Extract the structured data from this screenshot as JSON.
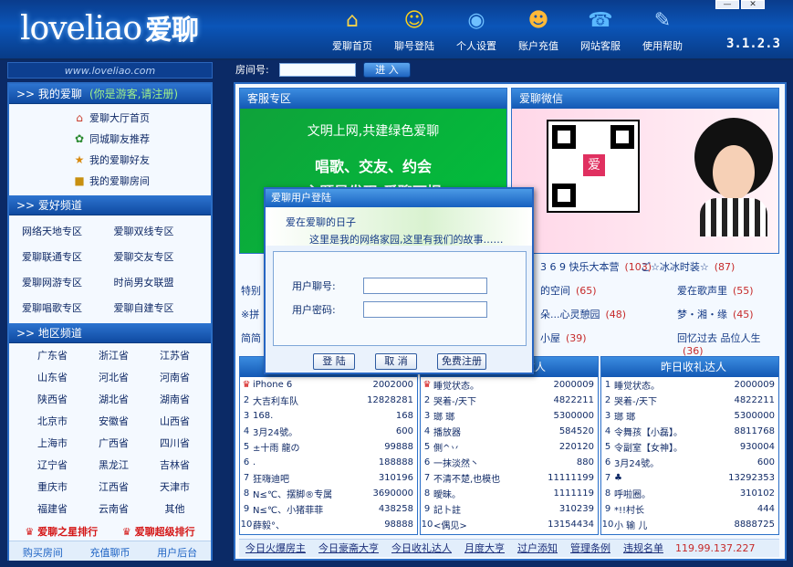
{
  "header": {
    "logo_en": "loveliao",
    "logo_cn": "爱聊",
    "version": "3.1.2.3",
    "minimize_label": "—",
    "close_label": "✕",
    "nav": [
      {
        "label": "爱聊首页",
        "icon": "home-icon",
        "glyph": "⌂"
      },
      {
        "label": "聊号登陆",
        "icon": "user-login-icon",
        "glyph": "☺"
      },
      {
        "label": "个人设置",
        "icon": "settings-icon",
        "glyph": "◉"
      },
      {
        "label": "账户充值",
        "icon": "recharge-icon",
        "glyph": "☻"
      },
      {
        "label": "网站客服",
        "icon": "support-icon",
        "glyph": "☎"
      },
      {
        "label": "使用帮助",
        "icon": "help-icon",
        "glyph": "✎"
      }
    ]
  },
  "urlbar": {
    "text": "www.loveliao.com"
  },
  "roombar": {
    "label": "房间号:",
    "input_value": "",
    "enter_label": "进 入"
  },
  "sidebar": {
    "my_head": ">> 我的爱聊",
    "my_note": "(你是游客,请注册)",
    "home_links": [
      {
        "label": "爱聊大厅首页",
        "glyph": "⌂"
      },
      {
        "label": "同城聊友推荐",
        "glyph": "✿"
      },
      {
        "label": "我的爱聊好友",
        "glyph": "★"
      },
      {
        "label": "我的爱聊房间",
        "glyph": "■"
      }
    ],
    "hobby_head": ">> 爱好频道",
    "hobby_items": [
      "网络天地专区",
      "爱聊双线专区",
      "爱聊联通专区",
      "爱聊交友专区",
      "爱聊网游专区",
      "时尚男女联盟",
      "爱聊唱歌专区",
      "爱聊自建专区"
    ],
    "region_head": ">> 地区频道",
    "region_items": [
      "广东省",
      "浙江省",
      "江苏省",
      "山东省",
      "河北省",
      "河南省",
      "陕西省",
      "湖北省",
      "湖南省",
      "北京市",
      "安徽省",
      "山西省",
      "上海市",
      "广西省",
      "四川省",
      "辽宁省",
      "黑龙江",
      "吉林省",
      "重庆市",
      "江西省",
      "天津市",
      "福建省",
      "云南省",
      "其他"
    ],
    "rank_star": "爱聊之星排行",
    "rank_super": "爱聊超级排行",
    "bottom_links": [
      "购买房间",
      "充值聊币",
      "用户后台"
    ]
  },
  "main": {
    "service_head": "客服专区",
    "service_l1": "文明上网,共建绿色爱聊",
    "service_l2": "唱歌、交友、约会",
    "service_l3": "主题是发现,爱聊可提",
    "wechat_head": "爱聊微信",
    "qr_mark": "爱",
    "mid_rows": [
      {
        "text": "3 6 9 快乐大本营",
        "num": "(103)"
      },
      {
        "text": "ご☆冰冰时装☆",
        "num": "(87)"
      },
      {
        "text": "的空间",
        "num": "(65)"
      },
      {
        "text": "爱在歌声里",
        "num": "(55)"
      },
      {
        "text": "朵...心灵憩园",
        "num": "(48)"
      },
      {
        "text": "梦・湘・缘",
        "num": "(45)"
      },
      {
        "text": "小屋",
        "num": "(39)"
      },
      {
        "text": "回忆过去 品位人生",
        "num": "(36)"
      }
    ],
    "mid_left": [
      "特别",
      "※拼",
      "简简"
    ],
    "panels": [
      {
        "head": "",
        "rows": [
          {
            "i": "♛",
            "name": "iPhone 6",
            "value": "2002000"
          },
          {
            "i": "2",
            "name": "大吉利车队",
            "value": "12828281"
          },
          {
            "i": "3",
            "name": "168.",
            "value": "168"
          },
          {
            "i": "4",
            "name": "3月24號。",
            "value": "600"
          },
          {
            "i": "5",
            "name": "±十雨 龍の",
            "value": "99888"
          },
          {
            "i": "6",
            "name": ".",
            "value": "188888"
          },
          {
            "i": "7",
            "name": "狂嗨迪吧",
            "value": "310196"
          },
          {
            "i": "8",
            "name": "N≤℃、摆脚®专属",
            "value": "3690000"
          },
          {
            "i": "9",
            "name": "N≤℃、小猪菲菲",
            "value": "438258"
          },
          {
            "i": "10",
            "name": "薛毅°、",
            "value": "98888"
          }
        ]
      },
      {
        "head": "今日收礼达人",
        "rows": [
          {
            "i": "♛",
            "name": "睡觉状态。",
            "value": "2000009"
          },
          {
            "i": "2",
            "name": "哭着-/天下",
            "value": "4822211"
          },
          {
            "i": "3",
            "name": "瑯 瑯",
            "value": "5300000"
          },
          {
            "i": "4",
            "name": "播放器",
            "value": "584520"
          },
          {
            "i": "5",
            "name": "側^丷",
            "value": "220120"
          },
          {
            "i": "6",
            "name": "一抹淡然丶",
            "value": "880"
          },
          {
            "i": "7",
            "name": "不清不楚,也模也",
            "value": "11111199"
          },
          {
            "i": "8",
            "name": "曖昧。",
            "value": "1111119"
          },
          {
            "i": "9",
            "name": "記卜註",
            "value": "310239"
          },
          {
            "i": "10",
            "name": "<偶见>",
            "value": "13154434"
          }
        ]
      },
      {
        "head": "昨日收礼达人",
        "rows": [
          {
            "i": "1",
            "name": "睡觉状态。",
            "value": "2000009"
          },
          {
            "i": "2",
            "name": "哭着-/天下",
            "value": "4822211"
          },
          {
            "i": "3",
            "name": "瑯 瑯",
            "value": "5300000"
          },
          {
            "i": "4",
            "name": "令舞孩【小磊】。",
            "value": "8811768"
          },
          {
            "i": "5",
            "name": "令副室【女神】。",
            "value": "930004"
          },
          {
            "i": "6",
            "name": "3月24號。",
            "value": "600"
          },
          {
            "i": "7",
            "name": "♣",
            "value": "13292353"
          },
          {
            "i": "8",
            "name": "呼啦圈。",
            "value": "310102"
          },
          {
            "i": "9",
            "name": "*!!村长",
            "value": "444"
          },
          {
            "i": "10",
            "name": "小 输 儿",
            "value": "8888725"
          }
        ]
      }
    ],
    "footer": [
      "今日火爆房主",
      "今日豪斋大亨",
      "今日收礼达人",
      "月度大亨",
      "过户添知",
      "管理条例",
      "违规名单"
    ],
    "footer_ip": "119.99.137.227"
  },
  "dialog": {
    "title": "爱聊用户登陆",
    "banner1": "爱在爱聊的日子",
    "banner2": "这里是我的网络家园,这里有我们的故事……",
    "user_label": "用户聊号:",
    "pass_label": "用户密码:",
    "user_value": "",
    "pass_value": "",
    "login": "登 陆",
    "cancel": "取 消",
    "register": "免费注册"
  }
}
